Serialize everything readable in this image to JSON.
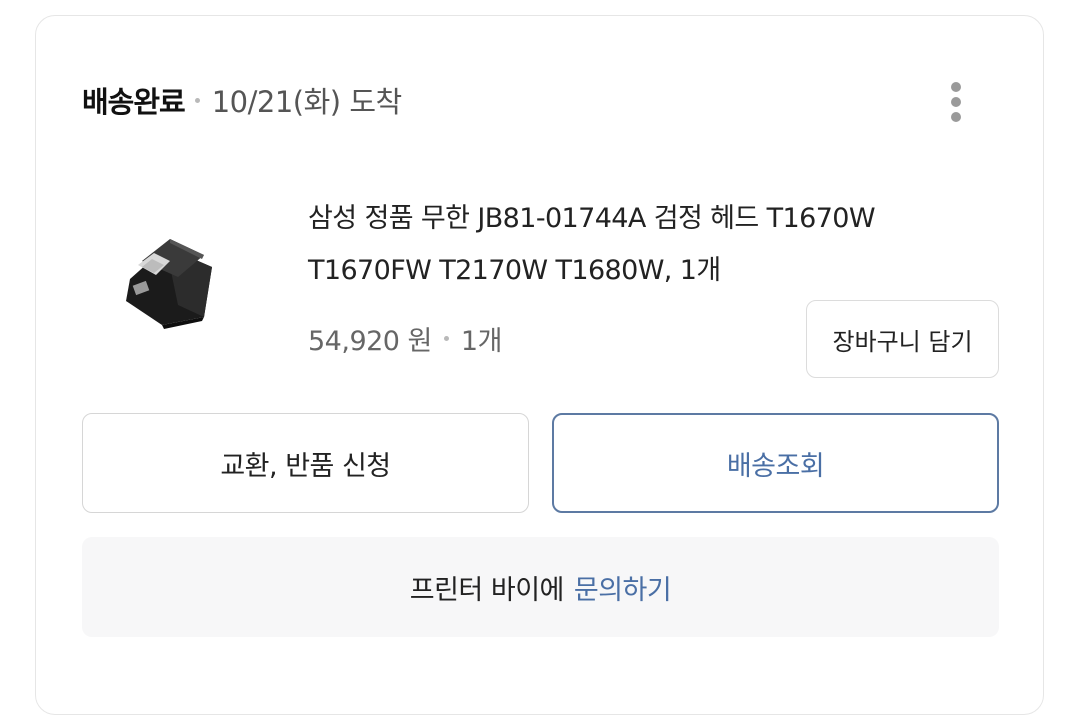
{
  "order": {
    "status": "배송완료",
    "arrival": "10/21(화) 도착"
  },
  "icons": {
    "more": "more-vertical-icon",
    "thumbnail": "printer-head-cartridge-image"
  },
  "product": {
    "title": "삼성 정품 무한 JB81-01744A 검정 헤드 T1670W T1670FW T2170W T1680W, 1개",
    "price": "54,920 원",
    "quantity": "1개"
  },
  "actions": {
    "cart_label": "장바구니 담기",
    "exchange_label": "교환, 반품 신청",
    "track_label": "배송조회"
  },
  "inquiry": {
    "seller_text": "프린터 바이에",
    "link_label": "문의하기"
  },
  "colors": {
    "accent": "#4a6fa5",
    "track_border": "#5d7aa3",
    "inquiry_bg": "#f7f7f8"
  }
}
